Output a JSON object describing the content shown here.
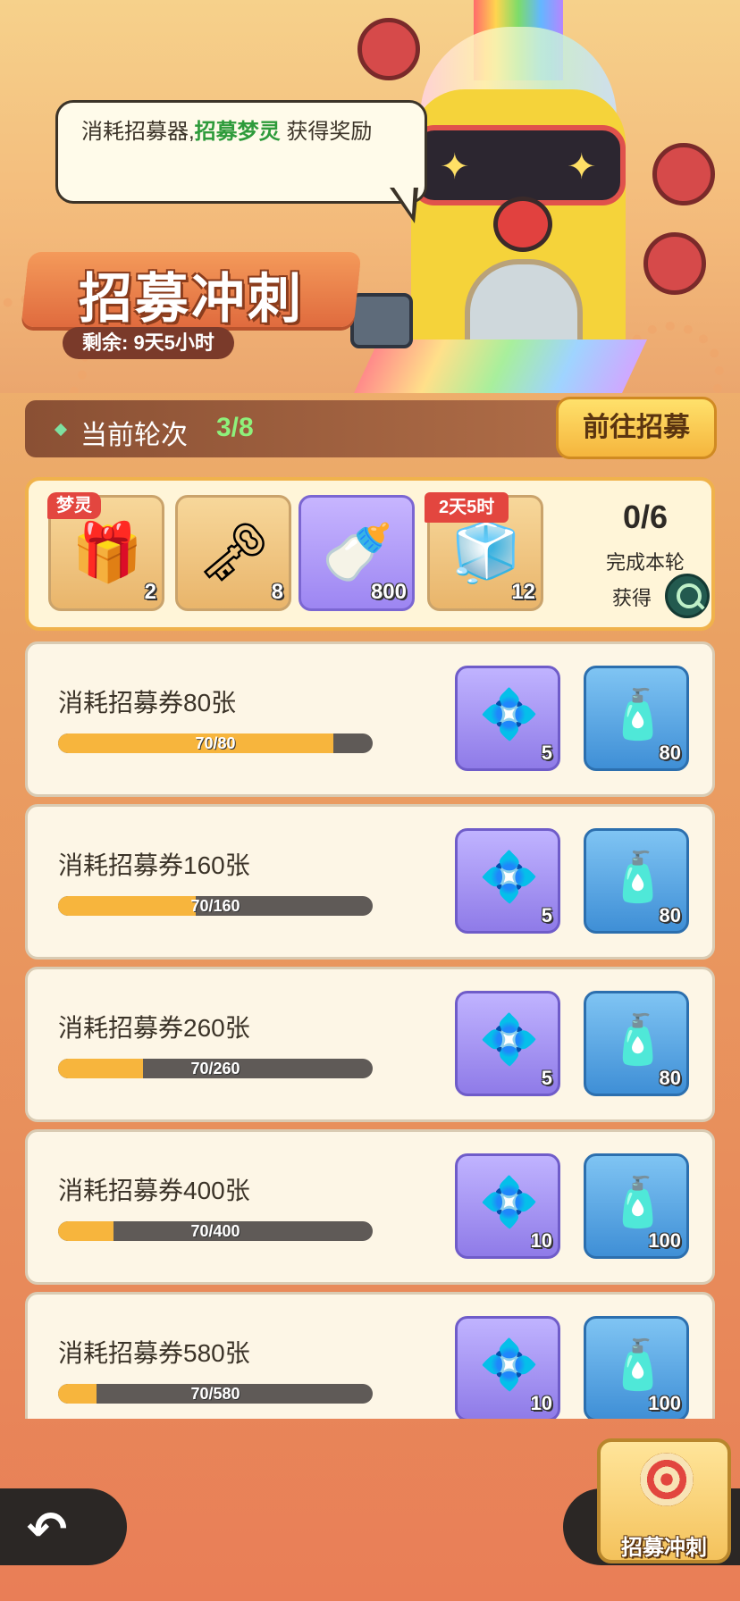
{
  "hero": {
    "bubble_text_prefix": "消耗招募器,",
    "bubble_highlight": "招募梦灵",
    "bubble_text_suffix": " 获得奖励",
    "title": "招募冲刺",
    "remaining": "剩余: 9天5小时"
  },
  "round": {
    "label": "当前轮次",
    "value": "3/8",
    "goto_button": "前往招募"
  },
  "round_rewards": {
    "items": [
      {
        "icon": "mystery-chest-icon",
        "count": "2",
        "tag": "梦灵",
        "style": "gold"
      },
      {
        "icon": "star-key-icon",
        "count": "8",
        "tag": "",
        "style": "gold"
      },
      {
        "icon": "rainbow-bottle-icon",
        "count": "800",
        "tag": "",
        "style": "purple"
      },
      {
        "icon": "crystal-cube-icon",
        "count": "12",
        "tag": "2天5时",
        "style": "gold"
      }
    ],
    "progress_count": "0/6",
    "progress_line1": "完成本轮",
    "progress_line2": "获得"
  },
  "tasks": [
    {
      "title": "消耗招募券80张",
      "progress_text": "70/80",
      "progress": 0.875,
      "rewards": [
        {
          "icon": "blue-orb-icon",
          "count": "5"
        },
        {
          "icon": "mystery-bottle-icon",
          "count": "80"
        }
      ]
    },
    {
      "title": "消耗招募券160张",
      "progress_text": "70/160",
      "progress": 0.4375,
      "rewards": [
        {
          "icon": "blue-orb-icon",
          "count": "5"
        },
        {
          "icon": "mystery-bottle-icon",
          "count": "80"
        }
      ]
    },
    {
      "title": "消耗招募券260张",
      "progress_text": "70/260",
      "progress": 0.269,
      "rewards": [
        {
          "icon": "blue-orb-icon",
          "count": "5"
        },
        {
          "icon": "mystery-bottle-icon",
          "count": "80"
        }
      ]
    },
    {
      "title": "消耗招募券400张",
      "progress_text": "70/400",
      "progress": 0.175,
      "rewards": [
        {
          "icon": "blue-orb-icon",
          "count": "10"
        },
        {
          "icon": "mystery-bottle-icon",
          "count": "100"
        }
      ]
    },
    {
      "title": "消耗招募券580张",
      "progress_text": "70/580",
      "progress": 0.121,
      "rewards": [
        {
          "icon": "blue-orb-icon",
          "count": "10"
        },
        {
          "icon": "mystery-bottle-icon",
          "count": "100"
        }
      ]
    }
  ],
  "bottom": {
    "sprint_label": "招募冲刺"
  },
  "colors": {
    "accent_green": "#2e9b3b",
    "progress_fill": "#f7b53d",
    "round_value": "#8ef07b"
  }
}
